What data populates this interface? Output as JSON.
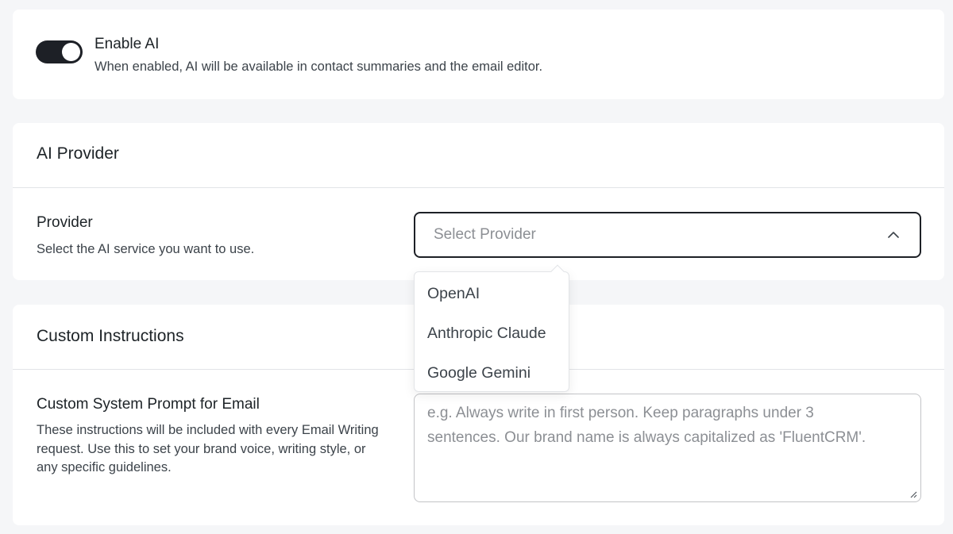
{
  "enable_ai": {
    "title": "Enable AI",
    "description": "When enabled, AI will be available in contact summaries and the email editor.",
    "enabled": true
  },
  "provider_section": {
    "header": "AI Provider",
    "field_title": "Provider",
    "field_description": "Select the AI service you want to use.",
    "select_placeholder": "Select Provider",
    "options": [
      "OpenAI",
      "Anthropic Claude",
      "Google Gemini"
    ]
  },
  "custom_section": {
    "header": "Custom Instructions",
    "field_title": "Custom System Prompt for Email",
    "field_description": "These instructions will be included with every Email Writing request. Use this to set your brand voice, writing style, or any specific guidelines.",
    "textarea_placeholder": "e.g. Always write in first person. Keep paragraphs under 3 sentences. Our brand name is always capitalized as 'FluentCRM'."
  },
  "colors": {
    "toggle_on": "#1d2026",
    "page_bg": "#f5f6f8",
    "card_bg": "#ffffff",
    "placeholder": "#8c8f94"
  }
}
